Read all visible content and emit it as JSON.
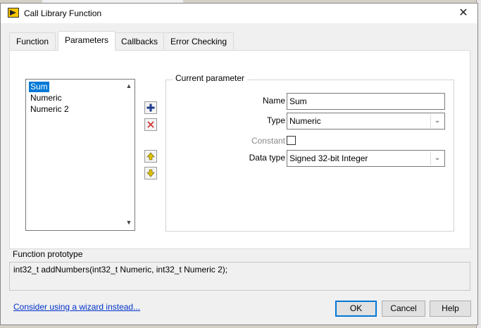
{
  "dialog": {
    "title": "Call Library Function",
    "close_glyph": "✕"
  },
  "tabs": [
    {
      "label": "Function"
    },
    {
      "label": "Parameters",
      "active": true
    },
    {
      "label": "Callbacks"
    },
    {
      "label": "Error Checking"
    }
  ],
  "params_list": {
    "items": [
      "Sum",
      "Numeric",
      "Numeric 2"
    ],
    "selected": "Sum"
  },
  "tools": {
    "add_icon": "plus-icon",
    "delete_icon": "delete-x-icon",
    "up_icon": "arrow-up-icon",
    "down_icon": "arrow-down-icon"
  },
  "current_parameter": {
    "title": "Current parameter",
    "name_label": "Name",
    "name_value": "Sum",
    "type_label": "Type",
    "type_value": "Numeric",
    "constant_label": "Constant",
    "constant_checked": false,
    "data_type_label": "Data type",
    "data_type_value": "Signed 32-bit Integer"
  },
  "prototype": {
    "title": "Function prototype",
    "text": "int32_t addNumbers(int32_t Numeric, int32_t Numeric 2);"
  },
  "footer": {
    "wizard_link": "Consider using a wizard instead...",
    "ok_label": "OK",
    "cancel_label": "Cancel",
    "help_label": "Help"
  },
  "colors": {
    "selection": "#0078d7",
    "link": "#0033cc",
    "add_icon": "#1f3c8f",
    "delete_icon": "#d03030",
    "arrow_icon": "#e0c000"
  }
}
